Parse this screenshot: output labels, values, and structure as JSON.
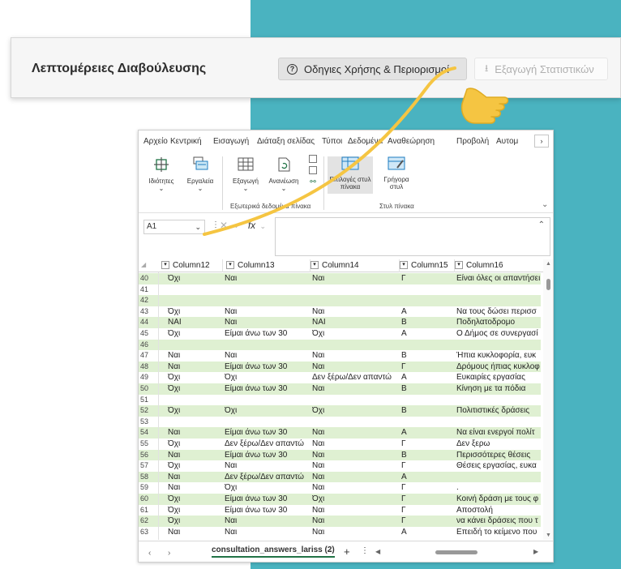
{
  "header": {
    "title": "Λεπτομέρειες Διαβούλευσης",
    "guide_button": "Οδηγιες Χρήσης & Περιορισμοί",
    "guide_icon": "question-circle-icon",
    "export_button": "Εξαγωγή Στατιστικών",
    "export_icon": "download-icon"
  },
  "excel": {
    "menu": [
      "Αρχείο",
      "Κεντρική",
      "Εισαγωγή",
      "Διάταξη σελίδας",
      "Τύποι",
      "Δεδομένα",
      "Αναθεώρηση",
      "Προβολή",
      "Αυτομ"
    ],
    "ribbon": {
      "properties": "Ιδιότητες",
      "tools": "Εργαλεία",
      "export": "Εξαγωγή",
      "refresh": "Ανανέωση",
      "table_style_options": "Επιλογές στυλ πίνακα",
      "quick_styles": "Γρήγορα στυλ",
      "group_external": "Εξωτερικά δεδομένα πίνακα",
      "group_styles": "Στυλ πίνακα"
    },
    "name_box": "A1",
    "fx": "fx",
    "columns": [
      "Column12",
      "Column13",
      "Column14",
      "Column15",
      "Column16"
    ],
    "rows": [
      {
        "n": "40",
        "c12": "Όχι",
        "c13": "Ναι",
        "c14": "Ναι",
        "c15": "Γ",
        "c16": "Είναι όλες οι απαντήσει",
        "g": true
      },
      {
        "n": "41",
        "c12": "",
        "c13": "",
        "c14": "",
        "c15": "",
        "c16": "",
        "g": false
      },
      {
        "n": "42",
        "c12": "",
        "c13": "",
        "c14": "",
        "c15": "",
        "c16": "",
        "g": true
      },
      {
        "n": "43",
        "c12": "Όχι",
        "c13": "Ναι",
        "c14": "Ναι",
        "c15": "Α",
        "c16": "Να τους δώσει περισσ",
        "g": false
      },
      {
        "n": "44",
        "c12": "ΝΑΙ",
        "c13": "Ναι",
        "c14": "ΝΑΙ",
        "c15": "Β",
        "c16": "Ποδηλατοδρομο",
        "g": true
      },
      {
        "n": "45",
        "c12": "Όχι",
        "c13": "Είμαι άνω των 30",
        "c14": "Όχι",
        "c15": "Α",
        "c16": "Ο Δήμος σε συνεργασί",
        "g": false
      },
      {
        "n": "46",
        "c12": "",
        "c13": "",
        "c14": "",
        "c15": "",
        "c16": "",
        "g": true
      },
      {
        "n": "47",
        "c12": "Ναι",
        "c13": "Ναι",
        "c14": "Ναι",
        "c15": "Β",
        "c16": "Ήπια κυκλοφορία, ευκ",
        "g": false
      },
      {
        "n": "48",
        "c12": "Ναι",
        "c13": "Είμαι άνω των 30",
        "c14": "Ναι",
        "c15": "Γ",
        "c16": "Δρόμους ήπιας κυκλοφ",
        "g": true
      },
      {
        "n": "49",
        "c12": "Όχι",
        "c13": "Όχι",
        "c14": "Δεν ξέρω/Δεν απαντώ",
        "c15": "Α",
        "c16": "Ευκαιρίες εργασίας",
        "g": false
      },
      {
        "n": "50",
        "c12": "Όχι",
        "c13": "Είμαι άνω των 30",
        "c14": "Ναι",
        "c15": "Β",
        "c16": "Κίνηση με τα πόδια",
        "g": true
      },
      {
        "n": "51",
        "c12": "",
        "c13": "",
        "c14": "",
        "c15": "",
        "c16": "",
        "g": false
      },
      {
        "n": "52",
        "c12": "Όχι",
        "c13": "Όχι",
        "c14": "Όχι",
        "c15": "Β",
        "c16": "Πολιτιστικές δράσεις",
        "g": true
      },
      {
        "n": "53",
        "c12": "",
        "c13": "",
        "c14": "",
        "c15": "",
        "c16": "",
        "g": false
      },
      {
        "n": "54",
        "c12": "Ναι",
        "c13": "Είμαι άνω των 30",
        "c14": "Ναι",
        "c15": "Α",
        "c16": "Να είναι ενεργοί πολίτ",
        "g": true
      },
      {
        "n": "55",
        "c12": "Όχι",
        "c13": "Δεν ξέρω/Δεν απαντώ",
        "c14": "Ναι",
        "c15": "Γ",
        "c16": "Δεν ξερω",
        "g": false
      },
      {
        "n": "56",
        "c12": "Ναι",
        "c13": "Είμαι άνω των 30",
        "c14": "Ναι",
        "c15": "Β",
        "c16": "Περισσότερες θέσεις",
        "g": true
      },
      {
        "n": "57",
        "c12": "Όχι",
        "c13": "Ναι",
        "c14": "Ναι",
        "c15": "Γ",
        "c16": "Θέσεις εργασίας, ευκα",
        "g": false
      },
      {
        "n": "58",
        "c12": "Ναι",
        "c13": "Δεν ξέρω/Δεν απαντώ",
        "c14": "Ναι",
        "c15": "Α",
        "c16": "",
        "g": true
      },
      {
        "n": "59",
        "c12": "Ναι",
        "c13": "Όχι",
        "c14": "Ναι",
        "c15": "Γ",
        "c16": ".",
        "g": false
      },
      {
        "n": "60",
        "c12": "Όχι",
        "c13": "Είμαι άνω των 30",
        "c14": "Όχι",
        "c15": "Γ",
        "c16": "Κοινή δράση με τους φ",
        "g": true
      },
      {
        "n": "61",
        "c12": "Όχι",
        "c13": "Είμαι άνω των 30",
        "c14": "Ναι",
        "c15": "Γ",
        "c16": "Αποστολή",
        "g": false
      },
      {
        "n": "62",
        "c12": "Όχι",
        "c13": "Ναι",
        "c14": "Ναι",
        "c15": "Γ",
        "c16": "να κάνει δράσεις που τ",
        "g": true
      },
      {
        "n": "63",
        "c12": "Ναι",
        "c13": "Ναι",
        "c14": "Ναι",
        "c15": "Α",
        "c16": "Επειδή το κείμενο που",
        "g": false
      }
    ],
    "sheet_tab": "consultation_answers_lariss (2)",
    "sheet_more": "···",
    "sheet_add": "+",
    "sheet_options": "⋮"
  },
  "colors": {
    "teal_background": "#4ab3c0",
    "arrow": "#f5c542",
    "hand": "#f5c542",
    "excel_green_row": "#dff0d2",
    "excel_accent": "#217346"
  },
  "overlay": {
    "arrow_icon": "curved-arrow-icon",
    "hand_icon": "pointing-hand-icon"
  }
}
